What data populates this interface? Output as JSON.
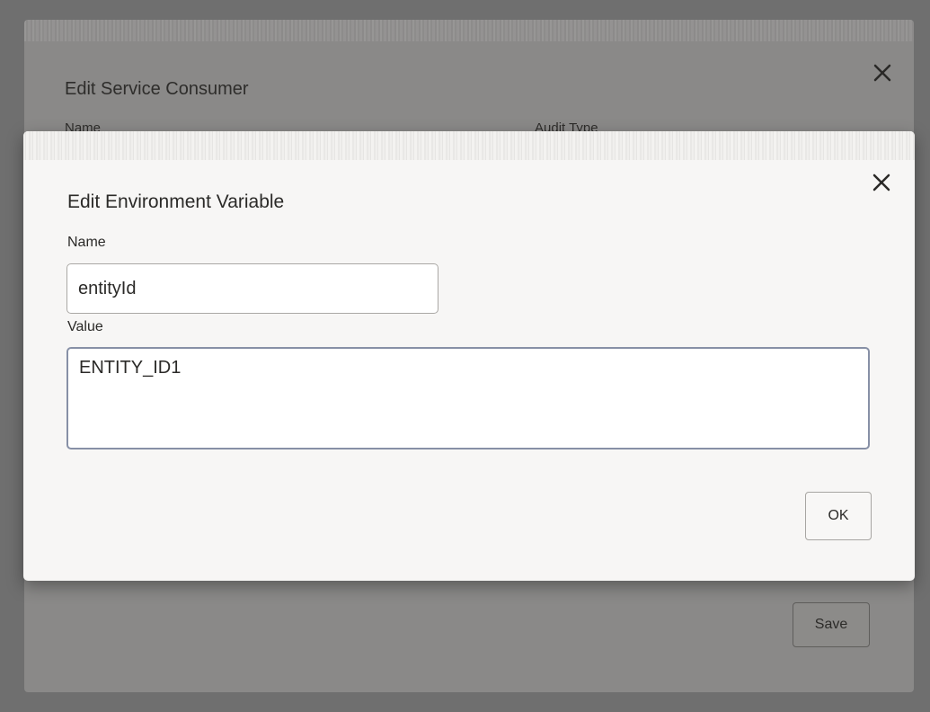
{
  "outer_dialog": {
    "title": "Edit Service Consumer",
    "name_label": "Name",
    "audit_type_label": "Audit Type",
    "save_label": "Save",
    "close_icon": "close-icon"
  },
  "inner_dialog": {
    "title": "Edit Environment Variable",
    "name_label": "Name",
    "name_value": "entityId",
    "value_label": "Value",
    "value_value": "ENTITY_ID1",
    "ok_label": "OK",
    "close_icon": "close-icon"
  },
  "colors": {
    "overlay": "#6f6f6f",
    "dialog_bg": "#f7f6f5",
    "focus_border": "#8790a6",
    "text": "#2b2a28"
  }
}
